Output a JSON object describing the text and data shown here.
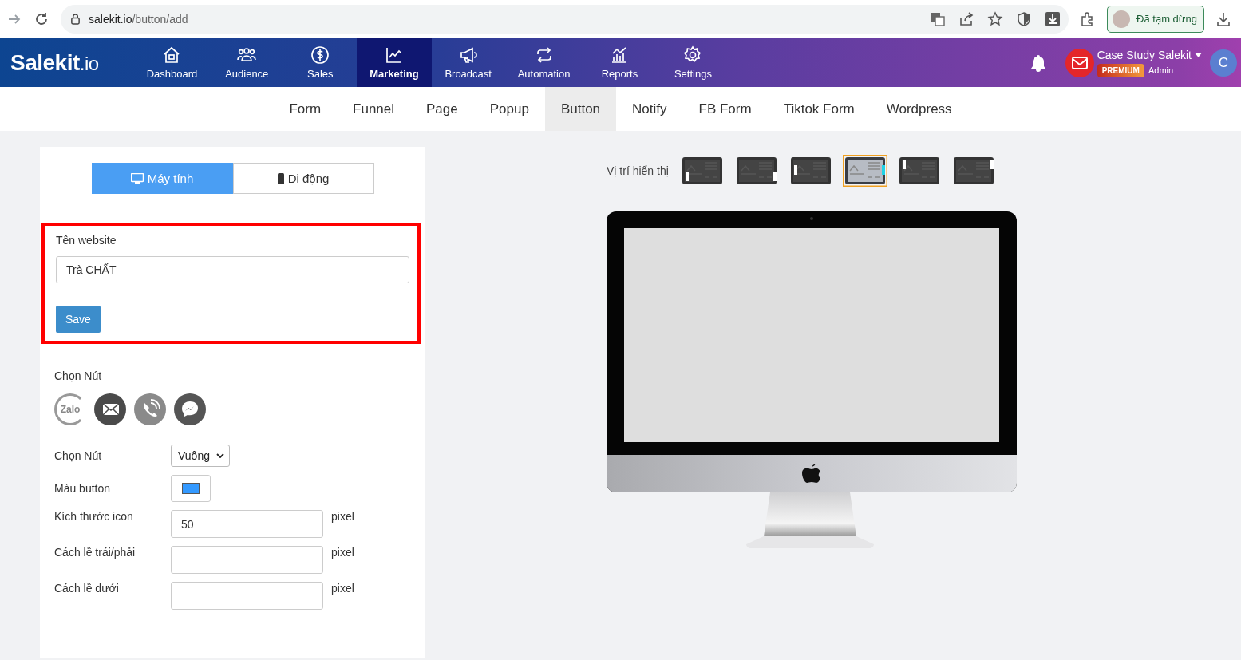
{
  "browser": {
    "url_host": "salekit.io",
    "url_path": "/button/add",
    "profile_label": "Đã tạm dừng"
  },
  "nav": {
    "logo_main": "Salekit",
    "logo_suffix": ".io",
    "items": [
      {
        "label": "Dashboard",
        "selected": false
      },
      {
        "label": "Audience",
        "selected": false
      },
      {
        "label": "Sales",
        "selected": false
      },
      {
        "label": "Marketing",
        "selected": true
      },
      {
        "label": "Broadcast",
        "selected": false
      },
      {
        "label": "Automation",
        "selected": false
      },
      {
        "label": "Reports",
        "selected": false
      },
      {
        "label": "Settings",
        "selected": false
      }
    ],
    "user": {
      "name": "Case Study Salekit",
      "badge": "PREMIUM",
      "role": "Admin",
      "avatar_letter": "C"
    }
  },
  "subnav": [
    {
      "label": "Form",
      "selected": false
    },
    {
      "label": "Funnel",
      "selected": false
    },
    {
      "label": "Page",
      "selected": false
    },
    {
      "label": "Popup",
      "selected": false
    },
    {
      "label": "Button",
      "selected": true
    },
    {
      "label": "Notify",
      "selected": false
    },
    {
      "label": "FB Form",
      "selected": false
    },
    {
      "label": "Tiktok Form",
      "selected": false
    },
    {
      "label": "Wordpress",
      "selected": false
    }
  ],
  "device_tabs": [
    {
      "label": "Máy tính",
      "selected": true
    },
    {
      "label": "Di động",
      "selected": false
    }
  ],
  "website_form": {
    "label": "Tên website",
    "value": "Trà CHẤT",
    "save": "Save",
    "highlighted": true
  },
  "button_choices": {
    "label": "Chọn Nút",
    "options": [
      {
        "kind": "zalo",
        "text": "Zalo"
      },
      {
        "kind": "mail"
      },
      {
        "kind": "phone"
      },
      {
        "kind": "messenger"
      }
    ]
  },
  "settings": [
    {
      "kind": "select",
      "label": "Chọn Nút",
      "value": "Vuông"
    },
    {
      "kind": "color",
      "label": "Màu button",
      "color": "#3399ff"
    },
    {
      "kind": "number",
      "label": "Kích thước icon",
      "value": "50",
      "unit": "pixel"
    },
    {
      "kind": "number",
      "label": "Cách lề trái/phải",
      "unit": "pixel"
    },
    {
      "kind": "number",
      "label": "Cách lề dưới",
      "unit": "pixel"
    }
  ],
  "position": {
    "label": "Vị trí hiển thị",
    "options": [
      {
        "selected": false
      },
      {
        "selected": false
      },
      {
        "selected": false
      },
      {
        "selected": true
      },
      {
        "selected": false
      },
      {
        "selected": false
      }
    ]
  }
}
